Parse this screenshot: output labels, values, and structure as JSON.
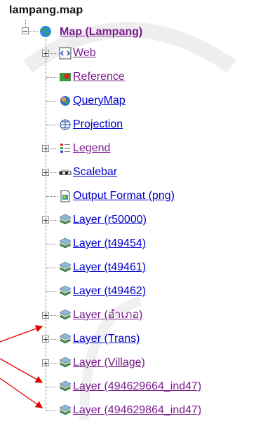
{
  "tree": {
    "file_name": "lampang.map",
    "root_label": "Map (Lampang)",
    "items": [
      {
        "label": "Web",
        "icon": "web-icon",
        "visited": true
      },
      {
        "label": "Reference",
        "icon": "reference-icon",
        "visited": true
      },
      {
        "label": "QueryMap",
        "icon": "querymap-icon",
        "visited": false
      },
      {
        "label": "Projection",
        "icon": "projection-icon",
        "visited": false
      },
      {
        "label": "Legend",
        "icon": "legend-icon",
        "visited": true
      },
      {
        "label": "Scalebar",
        "icon": "scalebar-icon",
        "visited": false
      },
      {
        "label": "Output Format (png)",
        "icon": "output-format-icon",
        "visited": false
      },
      {
        "label": "Layer (r50000)",
        "icon": "layer-icon",
        "visited": false
      },
      {
        "label": "Layer (t49454)",
        "icon": "layer-icon",
        "visited": false
      },
      {
        "label": "Layer (t49461)",
        "icon": "layer-icon",
        "visited": false
      },
      {
        "label": "Layer (t49462)",
        "icon": "layer-icon",
        "visited": false
      },
      {
        "label": "Layer (อำเภอ)",
        "icon": "layer-icon",
        "visited": true
      },
      {
        "label": "Layer (Trans)",
        "icon": "layer-icon",
        "visited": false
      },
      {
        "label": "Layer (Village)",
        "icon": "layer-icon",
        "visited": true
      },
      {
        "label": "Layer (494629664_ind47)",
        "icon": "layer-icon",
        "visited": true
      },
      {
        "label": "Layer (494629864_ind47)",
        "icon": "layer-icon",
        "visited": true
      }
    ]
  },
  "colors": {
    "link": "#0000cc",
    "visited": "#7a1c8c",
    "arrow": "#e00000"
  }
}
